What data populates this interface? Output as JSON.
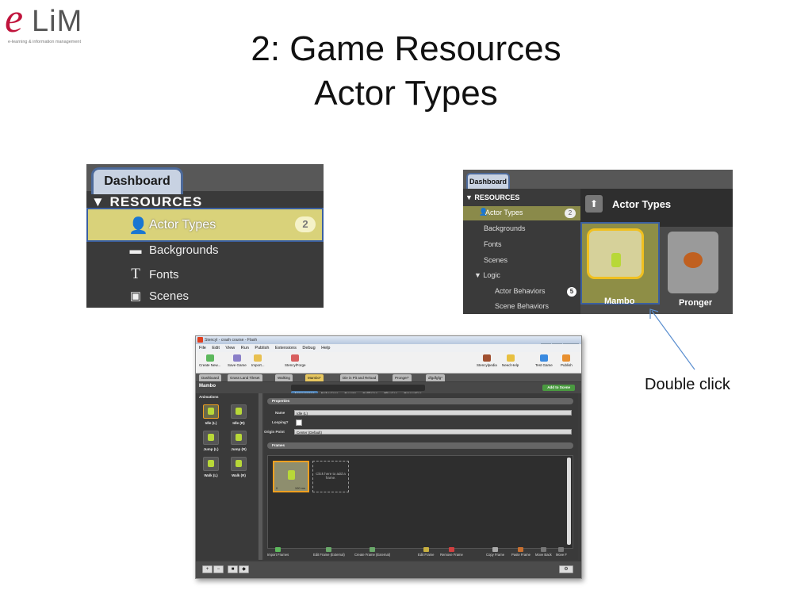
{
  "logo": {
    "mark": "e",
    "word": "LiM",
    "tagline": "e-learning & information management"
  },
  "title": {
    "line1": "2: Game Resources",
    "line2": "Actor Types"
  },
  "panel1": {
    "tab": "Dashboard",
    "resources_header": "▼ RESOURCES",
    "selected": {
      "label": "Actor Types",
      "badge": "2"
    },
    "items": [
      "Backgrounds",
      "Fonts",
      "Scenes"
    ]
  },
  "panel2": {
    "tab": "Dashboard",
    "resources_header": "▼ RESOURCES",
    "selected": {
      "label": "Actor Types",
      "badge": "2"
    },
    "items": [
      "Backgrounds",
      "Fonts",
      "Scenes",
      "▼ Logic",
      "Actor Behaviors",
      "Scene Behaviors"
    ],
    "actor_behaviors_badge": "5",
    "header_title": "Actor Types",
    "actors": [
      "Mambo",
      "Pronger"
    ]
  },
  "callout": "Double click",
  "stencyl": {
    "window_title": "Stencyl - crash course - Flash",
    "menu": [
      "File",
      "Edit",
      "View",
      "Run",
      "Publish",
      "Extensions",
      "Debug",
      "Help"
    ],
    "toolbar_left": [
      "Create New...",
      "Save Game",
      "Import...",
      "StencylForge"
    ],
    "toolbar_right": [
      "Stencylpedia",
      "Need Help",
      "Test Game",
      "Publish"
    ],
    "doc_tabs": [
      "Dashboard",
      "Grass Land Tileset",
      "Walking",
      "Mambo*",
      "Die in Pit and Reload",
      "Pronger*",
      "dfgdfgfg*"
    ],
    "header_name": "Mambo",
    "sub_tabs": [
      "Appearance",
      "Behaviors",
      "Events",
      "Collision",
      "Physics",
      "Properties"
    ],
    "add_to_scene": "Add to Scene",
    "animations_label": "Animations",
    "animations": [
      "Idle (L)",
      "Idle (R)",
      "Jump (L)",
      "Jump (R)",
      "Walk (L)",
      "Walk (R)"
    ],
    "properties_label": "Properties",
    "name_label": "Name",
    "name_value": "Idle (L)",
    "looping_label": "Looping?",
    "origin_label": "Origin Point",
    "origin_value": "Center (Default)",
    "frames_label": "Frames",
    "frame_index": "0",
    "frame_ms": "100 ms",
    "add_frame": "Click here to add a frame.",
    "actions": [
      "Import Frames",
      "Edit Frame (External)",
      "Create Frame (External)",
      "Edit Frame",
      "Remove Frame",
      "Copy Frame",
      "Paste Frame",
      "Move Back",
      "Move F"
    ],
    "bottom_buttons": [
      "+",
      "−",
      "■",
      "◆"
    ]
  },
  "colors": {
    "logo_red": "#c0143c",
    "selection_yellow": "#d9d27a",
    "selection_border": "#3b5fa0",
    "arrow_blue": "#5b8fd0"
  }
}
